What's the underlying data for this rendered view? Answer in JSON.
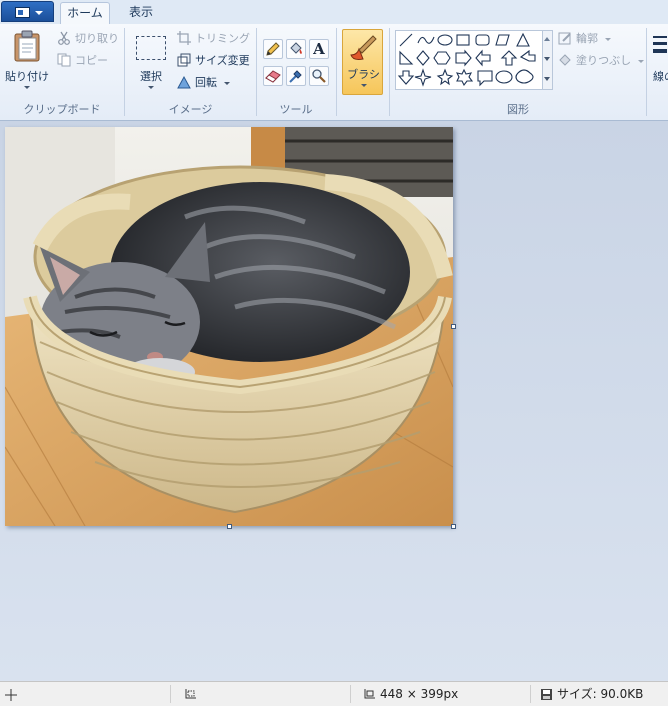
{
  "tabs": {
    "home": "ホーム",
    "view": "表示"
  },
  "clipboard": {
    "paste": "貼り付け",
    "cut": "切り取り",
    "copy": "コピー",
    "group": "クリップボード"
  },
  "image": {
    "select": "選択",
    "crop": "トリミング",
    "resize": "サイズ変更",
    "rotate": "回転",
    "group": "イメージ"
  },
  "tools": {
    "group": "ツール",
    "text_glyph": "A"
  },
  "brushes": {
    "label": "ブラシ"
  },
  "shapes": {
    "outline": "輪郭",
    "fill": "塗りつぶし",
    "group": "図形"
  },
  "size": {
    "label": "線の"
  },
  "status": {
    "dimensions": "448 × 399px",
    "filesize": "サイズ: 90.0KB"
  },
  "colors": {
    "accent": "#f6c65a",
    "app_button": "#2a63b3",
    "ribbon": "#eef3fa",
    "canvas_bg": "#d3dcea"
  }
}
